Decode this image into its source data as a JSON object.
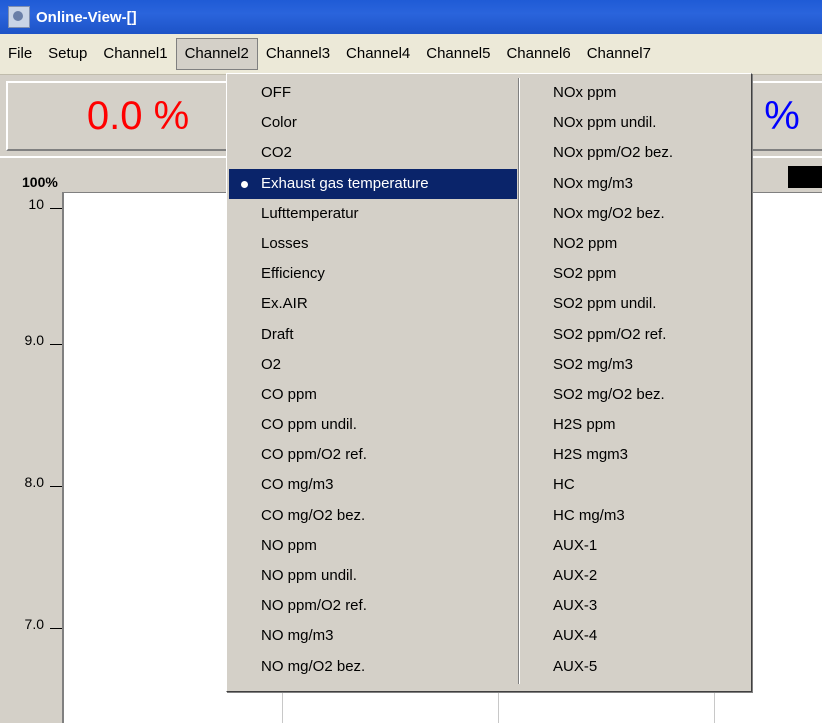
{
  "window": {
    "title": "Online-View-[]",
    "icon": "app-icon"
  },
  "menubar": {
    "items": [
      "File",
      "Setup",
      "Channel1",
      "Channel2",
      "Channel3",
      "Channel4",
      "Channel5",
      "Channel6",
      "Channel7"
    ],
    "active": "Channel2"
  },
  "values": {
    "channel1_display": "0.0 %",
    "channel1_color": "#ff0000",
    "channel2_display": "%",
    "channel2_color": "#0000ff"
  },
  "chart": {
    "top_label": "100%",
    "y_ticks": [
      "10",
      "9.0",
      "8.0",
      "7.0"
    ]
  },
  "dropdown": {
    "left_column": [
      "OFF",
      "Color",
      "CO2",
      "Exhaust gas temperature",
      "Lufttemperatur",
      "Losses",
      "Efficiency",
      "Ex.AIR",
      "Draft",
      "O2",
      "CO ppm",
      "CO ppm undil.",
      "CO ppm/O2 ref.",
      "CO mg/m3",
      "CO mg/O2 bez.",
      "NO ppm",
      "NO ppm undil.",
      "NO ppm/O2 ref.",
      "NO mg/m3",
      "NO mg/O2 bez."
    ],
    "right_column": [
      "NOx ppm",
      "NOx ppm undil.",
      "NOx ppm/O2 bez.",
      "NOx mg/m3",
      "NOx mg/O2 bez.",
      "NO2 ppm",
      "SO2 ppm",
      "SO2 ppm undil.",
      "SO2 ppm/O2 ref.",
      "SO2 mg/m3",
      "SO2 mg/O2 bez.",
      "H2S ppm",
      "H2S mgm3",
      "HC",
      "HC mg/m3",
      "AUX-1",
      "AUX-2",
      "AUX-3",
      "AUX-4",
      "AUX-5"
    ],
    "selected": "Exhaust gas temperature",
    "selection_color": "#0a246a"
  }
}
